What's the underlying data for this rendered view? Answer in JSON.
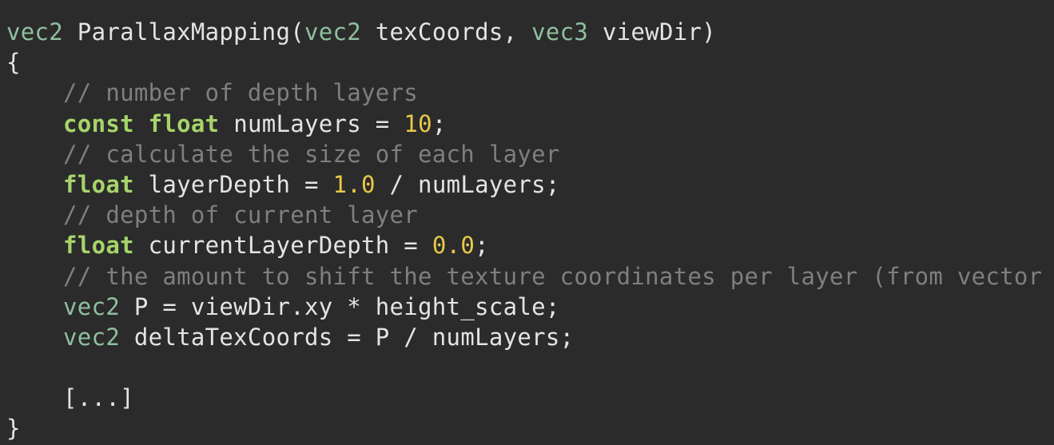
{
  "lines": [
    [
      {
        "t": "vec2",
        "c": "kw-type"
      },
      {
        "t": " ParallaxMapping(",
        "c": "plain"
      },
      {
        "t": "vec2",
        "c": "kw-type"
      },
      {
        "t": " texCoords, ",
        "c": "plain"
      },
      {
        "t": "vec3",
        "c": "kw-type"
      },
      {
        "t": " viewDir)",
        "c": "plain"
      }
    ],
    [
      {
        "t": "{",
        "c": "plain"
      }
    ],
    [
      {
        "t": "    // number of depth layers",
        "c": "comment"
      }
    ],
    [
      {
        "t": "    ",
        "c": "plain"
      },
      {
        "t": "const",
        "c": "kw-bold"
      },
      {
        "t": " ",
        "c": "plain"
      },
      {
        "t": "float",
        "c": "kw-bold"
      },
      {
        "t": " numLayers = ",
        "c": "plain"
      },
      {
        "t": "10",
        "c": "num"
      },
      {
        "t": ";",
        "c": "plain"
      }
    ],
    [
      {
        "t": "    // calculate the size of each layer",
        "c": "comment"
      }
    ],
    [
      {
        "t": "    ",
        "c": "plain"
      },
      {
        "t": "float",
        "c": "kw-bold"
      },
      {
        "t": " layerDepth = ",
        "c": "plain"
      },
      {
        "t": "1.0",
        "c": "num"
      },
      {
        "t": " / numLayers;",
        "c": "plain"
      }
    ],
    [
      {
        "t": "    // depth of current layer",
        "c": "comment"
      }
    ],
    [
      {
        "t": "    ",
        "c": "plain"
      },
      {
        "t": "float",
        "c": "kw-bold"
      },
      {
        "t": " currentLayerDepth = ",
        "c": "plain"
      },
      {
        "t": "0.0",
        "c": "num"
      },
      {
        "t": ";",
        "c": "plain"
      }
    ],
    [
      {
        "t": "    // the amount to shift the texture coordinates per layer (from vector P)",
        "c": "comment"
      }
    ],
    [
      {
        "t": "    ",
        "c": "plain"
      },
      {
        "t": "vec2",
        "c": "kw-type"
      },
      {
        "t": " P = viewDir.xy * height_scale;",
        "c": "plain"
      }
    ],
    [
      {
        "t": "    ",
        "c": "plain"
      },
      {
        "t": "vec2",
        "c": "kw-type"
      },
      {
        "t": " deltaTexCoords = P / numLayers;",
        "c": "plain"
      }
    ],
    [
      {
        "t": "",
        "c": "plain"
      }
    ],
    [
      {
        "t": "    [...]",
        "c": "plain"
      }
    ],
    [
      {
        "t": "}",
        "c": "plain"
      }
    ]
  ],
  "colors": {
    "background": "#2b2b2b",
    "text": "#e4e4e4",
    "type_keyword": "#8fbf9f",
    "qualifier_keyword": "#a6d46a",
    "number": "#e8c84a",
    "comment": "#7f7f7f"
  }
}
